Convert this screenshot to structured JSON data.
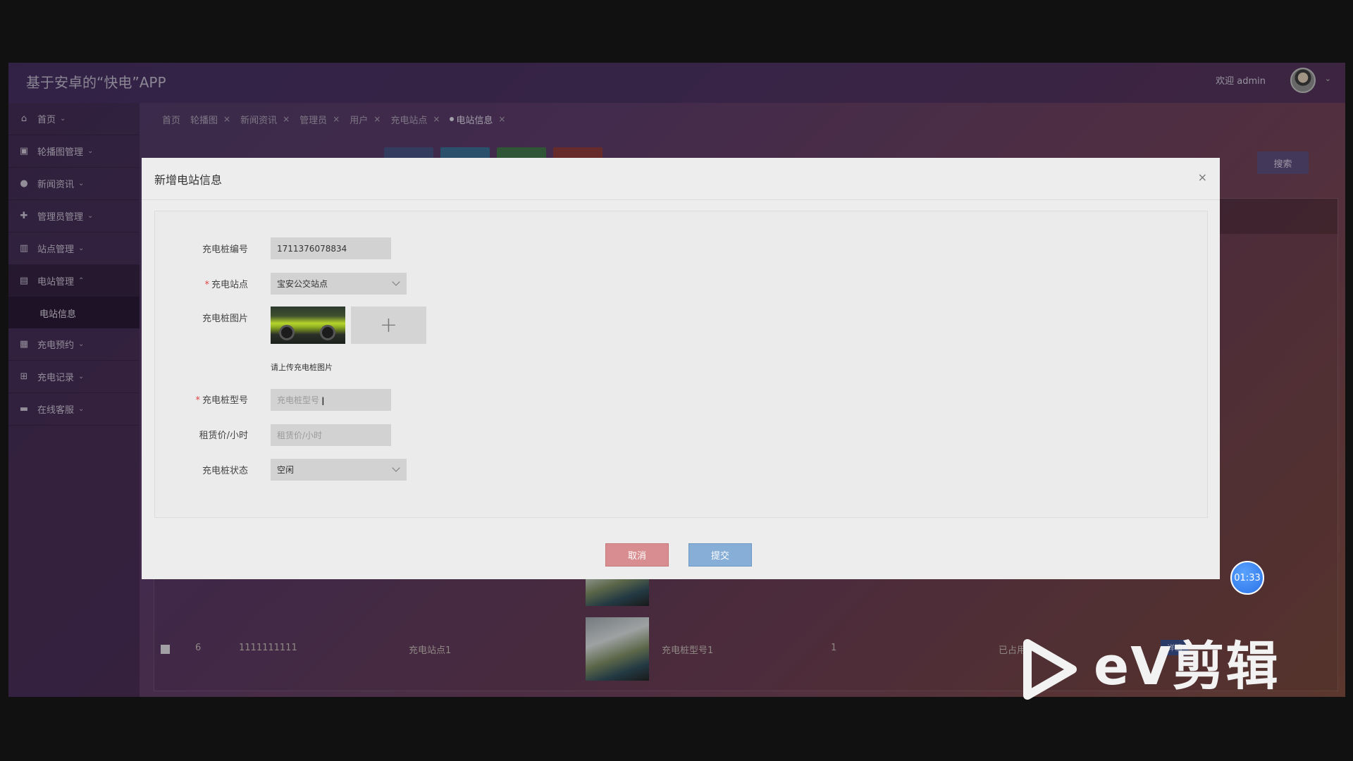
{
  "header": {
    "app_title": "基于安卓的“快电”APP",
    "welcome": "欢迎 admin"
  },
  "sidebar": {
    "items": [
      {
        "label": "首页",
        "icon": "home-icon"
      },
      {
        "label": "轮播图管理",
        "icon": "carousel-icon"
      },
      {
        "label": "新闻资讯",
        "icon": "news-icon"
      },
      {
        "label": "管理员管理",
        "icon": "admin-icon"
      },
      {
        "label": "站点管理",
        "icon": "station-icon"
      },
      {
        "label": "电站管理",
        "icon": "power-station-icon"
      },
      {
        "label": "充电预约",
        "icon": "reservation-icon"
      },
      {
        "label": "充电记录",
        "icon": "records-icon"
      },
      {
        "label": "在线客服",
        "icon": "support-icon"
      }
    ],
    "sub_item": "电站信息"
  },
  "tabs": [
    "首页",
    "轮播图",
    "新闻资讯",
    "管理员",
    "用户",
    "充电站点",
    "电站信息"
  ],
  "toolbar": {
    "search_label": "搜索"
  },
  "bg_table": {
    "rows": [
      {
        "id": "6",
        "code": "1111111111",
        "station": "充电站点1",
        "model": "充电桩型号1",
        "price": "1",
        "status": "已占用",
        "action": "详情"
      }
    ]
  },
  "modal": {
    "title": "新增电站信息",
    "fields": {
      "code_label": "充电桩编号",
      "code_value": "1711376078834",
      "station_label": "充电站点",
      "station_value": "宝安公交站点",
      "image_label": "充电桩图片",
      "image_hint": "请上传充电桩图片",
      "model_label": "充电桩型号",
      "model_placeholder": "充电桩型号",
      "price_label": "租赁价/小时",
      "price_placeholder": "租赁价/小时",
      "status_label": "充电桩状态",
      "status_value": "空闲"
    },
    "cancel_label": "取消",
    "submit_label": "提交"
  },
  "timer": "01:33",
  "watermark": "eV剪辑"
}
